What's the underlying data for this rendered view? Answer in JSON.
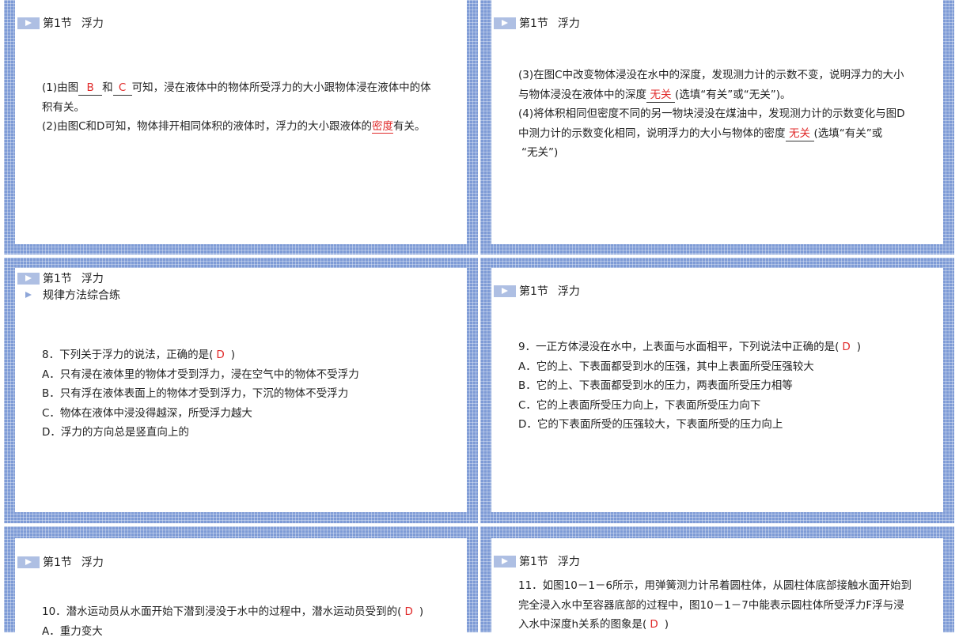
{
  "section_title": "第1节",
  "section_name": "浮力",
  "slides": [
    {
      "lines": [
        {
          "t1": "(1)由图",
          "a1": "B",
          "t2": "和",
          "a2": "C",
          "t3": "可知，浸在液体中的物体所受浮力的大小跟物体浸在液体中的体"
        },
        {
          "t1": "积有关。"
        },
        {
          "t1": "(2)由图C和D可知，物体排开相同体积的液体时，浮力的大小跟液体的",
          "a1": "密度",
          "t2": "有关。"
        }
      ]
    },
    {
      "lines": [
        {
          "t1": "(3)在图C中改变物体浸没在水中的深度，发现测力计的示数不变，说明浮力的大小"
        },
        {
          "t1": "与物体浸没在液体中的深度",
          "a1": "无关",
          "t2": "(选填“有关”或“无关”)。"
        },
        {
          "t1": "(4)将体积相同但密度不同的另一物块浸没在煤油中，发现测力计的示数变化与图D"
        },
        {
          "t1": "中测力计的示数变化相同，说明浮力的大小与物体的密度",
          "a1": "无关",
          "t2": "(选填“有关”或"
        },
        {
          "t1": "“无关”)"
        }
      ]
    },
    {
      "subtitle": "规律方法综合练",
      "question": {
        "t1": "8．下列关于浮力的说法，正确的是(",
        "a1": "D",
        "t2": ")"
      },
      "options": [
        "A．只有浸在液体里的物体才受到浮力，浸在空气中的物体不受浮力",
        "B．只有浮在液体表面上的物体才受到浮力，下沉的物体不受浮力",
        "C．物体在液体中浸没得越深，所受浮力越大",
        "D．浮力的方向总是竖直向上的"
      ]
    },
    {
      "question": {
        "t1": "9．一正方体浸没在水中，上表面与水面相平，下列说法中正确的是(",
        "a1": "D",
        "t2": ")"
      },
      "options": [
        "A．它的上、下表面都受到水的压强，其中上表面所受压强较大",
        "B．它的上、下表面都受到水的压力，两表面所受压力相等",
        "C．它的上表面所受压力向上，下表面所受压力向下",
        "D．它的下表面所受的压强较大，下表面所受的压力向上"
      ]
    },
    {
      "question": {
        "t1": "10．潜水运动员从水面开始下潜到浸没于水中的过程中，潜水运动员受到的(",
        "a1": "D",
        "t2": ")"
      },
      "options": [
        "A．重力变大"
      ]
    },
    {
      "lines": [
        {
          "t1": "11．如图10－1－6所示，用弹簧测力计吊着圆柱体，从圆柱体底部接触水面开始到"
        },
        {
          "t1": "完全浸入水中至容器底部的过程中，图10－1－7中能表示圆柱体所受浮力F浮与浸"
        },
        {
          "t1": "入水中深度h关系的图象是(",
          "a1": "D",
          "t2": ")"
        }
      ]
    }
  ]
}
